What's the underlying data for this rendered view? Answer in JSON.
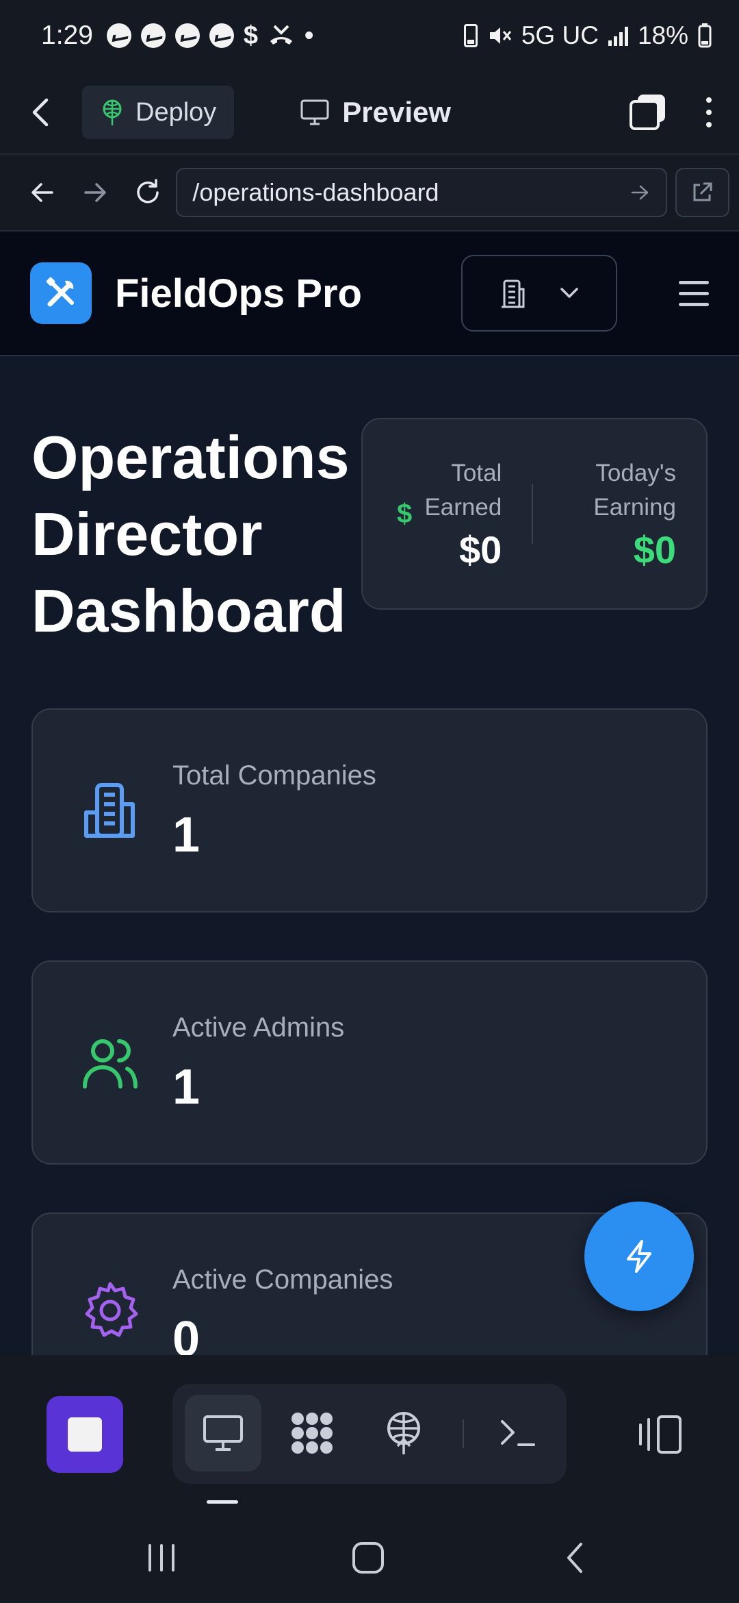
{
  "status_bar": {
    "time": "1:29",
    "dollar_glyph": "$",
    "dot_glyph": "•",
    "network": "5G UC",
    "battery": "18%",
    "icons": [
      "messenger-icon",
      "messenger-icon",
      "messenger-icon",
      "messenger-icon",
      "dollar-icon",
      "missed-call-icon",
      "notification-dot-icon",
      "battery-saver-icon",
      "mute-icon",
      "signal-icon",
      "battery-icon"
    ]
  },
  "toolbar": {
    "deploy_label": "Deploy",
    "preview_label": "Preview"
  },
  "url_bar": {
    "path": "/operations-dashboard"
  },
  "app": {
    "name": "FieldOps Pro",
    "accent": "#2a8ff0"
  },
  "page": {
    "title": "Operations Director Dashboard"
  },
  "earnings": {
    "total_label": "Total Earned",
    "total_value": "$0",
    "today_label": "Today's Earning",
    "today_value": "$0",
    "dollar_glyph": "$",
    "positive_color": "#3ddc7a"
  },
  "stats": [
    {
      "label": "Total Companies",
      "value": "1",
      "icon": "building-icon",
      "color": "#5b9cf5"
    },
    {
      "label": "Active Admins",
      "value": "1",
      "icon": "users-icon",
      "color": "#37c76d"
    },
    {
      "label": "Active Companies",
      "value": "0",
      "icon": "gear-icon",
      "color": "#a562f0"
    }
  ],
  "dock": {
    "items": [
      "preview-icon",
      "extensions-icon",
      "deploy-icon",
      "terminal-icon"
    ]
  }
}
